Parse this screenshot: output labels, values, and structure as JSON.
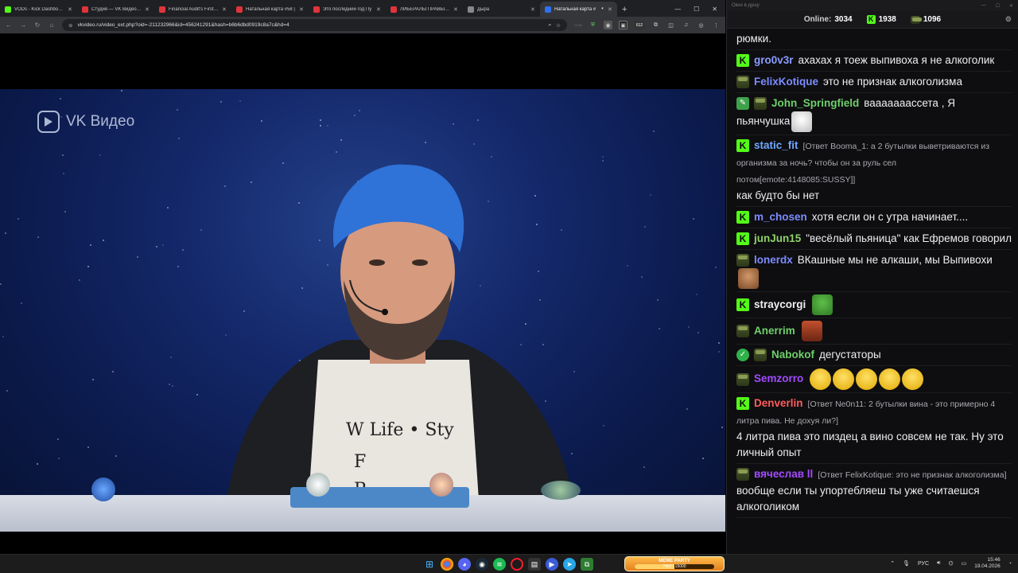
{
  "browser": {
    "tabs": [
      {
        "label": "VODs - Kick Dashboard",
        "color": "#53fc18",
        "active": false
      },
      {
        "label": "Студия — VK Видео Live",
        "color": "#e0343b",
        "active": false
      },
      {
        "label": "Financial Audit's First Nec",
        "color": "#e0343b",
        "active": false
      },
      {
        "label": "Натальная карта #58 |",
        "color": "#e0343b",
        "active": false
      },
      {
        "label": "Это последний год Пу",
        "color": "#e0343b",
        "active": false
      },
      {
        "label": "ЛИБЕРАЛЫ ПРАВЫ В 5",
        "color": "#e0343b",
        "active": false
      },
      {
        "label": "Дыра",
        "color": "#888888",
        "active": false
      },
      {
        "label": "Натальная карта #",
        "color": "#2f6ff0",
        "active": true
      }
    ],
    "url": "vkvideo.ru/video_ext.php?oid=-211232966&id=456241291&hash=b6b6dbd0919c8a7c&hd=4",
    "extension_badge": "612",
    "video": {
      "watermark": "VK Видео"
    }
  },
  "chat": {
    "window_title": "Окно в душу",
    "online_label": "Online:",
    "online_count": "3034",
    "kick_count": "1938",
    "hat_count": "1096",
    "messages": [
      {
        "badges": [],
        "user": "",
        "color": "#efeff1",
        "reply": "",
        "text": "рюмки.",
        "emotes": []
      },
      {
        "badges": [
          "kick"
        ],
        "user": "gro0v3r",
        "color": "#8a9dff",
        "reply": "",
        "text": "ахахах я тоеж выпивоха я не алкоголик",
        "emotes": []
      },
      {
        "badges": [
          "hat"
        ],
        "user": "FelixKotique",
        "color": "#7c8cff",
        "reply": "",
        "text": "это не признак алкоголизма",
        "emotes": []
      },
      {
        "badges": [
          "pencil",
          "hat"
        ],
        "user": "John_Springfield",
        "color": "#6fd06b",
        "reply": "",
        "text": "вааааааассета , Я пьянчушка",
        "emotes": [
          "sketch"
        ]
      },
      {
        "badges": [
          "kick"
        ],
        "user": "static_fit",
        "color": "#6fa8ff",
        "reply": "[Ответ Booma_1: а 2 бутылки выветриваются из организма за ночь? чтобы он за руль сел потом[emote:4148085:SUSSY]]",
        "text": "как будто бы нет",
        "emotes": []
      },
      {
        "badges": [
          "kick"
        ],
        "user": "m_chosen",
        "color": "#7c8cff",
        "reply": "",
        "text": "хотя если он с утра начинает....",
        "emotes": []
      },
      {
        "badges": [
          "kick"
        ],
        "user": "junJun15",
        "color": "#8fd16a",
        "reply": "",
        "text": "\"весёлый пьяница\" как Ефремов говорил",
        "emotes": []
      },
      {
        "badges": [
          "hat"
        ],
        "user": "lonerdx",
        "color": "#7c8cff",
        "reply": "",
        "text": "ВКашные мы не алкаши, мы Выпивохи",
        "emotes": [
          "face"
        ]
      },
      {
        "badges": [
          "kick"
        ],
        "user": "straycorgi",
        "color": "#efeff1",
        "reply": "",
        "text": "",
        "emotes": [
          "pepe"
        ]
      },
      {
        "badges": [
          "hat"
        ],
        "user": "Anerrim",
        "color": "#6fd06b",
        "reply": "",
        "text": "",
        "emotes": [
          "anerrim"
        ]
      },
      {
        "badges": [
          "verified",
          "hat"
        ],
        "user": "Nabokof",
        "color": "#6fd06b",
        "reply": "",
        "text": "дегустаторы",
        "emotes": []
      },
      {
        "badges": [
          "hat"
        ],
        "user": "Semzorro",
        "color": "#a24bff",
        "reply": "",
        "text": "",
        "emotes": [
          "laugh",
          "laugh",
          "laugh",
          "laugh",
          "laugh"
        ]
      },
      {
        "badges": [
          "kick"
        ],
        "user": "Denverlin",
        "color": "#ff5c5c",
        "reply": "[Ответ Ne0n11: 2 бутылки вина - это примерно 4 литра пива. Не дохуя ли?]",
        "text": "4 литра пива это пиздец а вино совсем не так. Ну это личный опыт",
        "emotes": []
      },
      {
        "badges": [
          "hat"
        ],
        "user": "вячеслав ll",
        "color": "#a24bff",
        "reply": "[Ответ FelixKotique: это не признак алкоголизма]",
        "text": "вообще если ты упортебляеш ты уже считаешся алкоголиком",
        "emotes": []
      }
    ]
  },
  "taskbar": {
    "meme_party": {
      "title": "MEME PARTY",
      "progress_text": "7497 / 15000",
      "progress": 0.4998
    },
    "lang": "РУС",
    "time": "15:46",
    "date": "19.04.2026"
  }
}
